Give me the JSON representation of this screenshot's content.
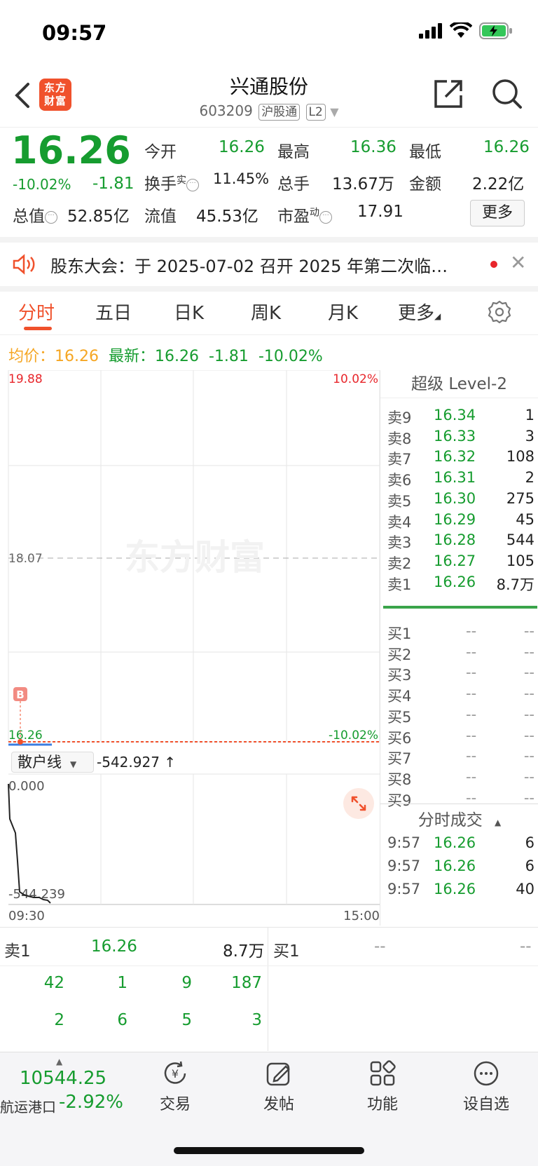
{
  "status": {
    "time": "09:57"
  },
  "nav": {
    "logo_line1": "东方",
    "logo_line2": "财富",
    "title": "兴通股份",
    "code": "603209",
    "tag1": "沪股通",
    "tag2": "L2"
  },
  "quote": {
    "price": "16.26",
    "pct": "-10.02%",
    "chg": "-1.81",
    "open_label": "今开",
    "open": "16.26",
    "high_label": "最高",
    "high": "16.36",
    "low_label": "最低",
    "low": "16.26",
    "turnover_label": "换手",
    "turnover_sup": "实",
    "turnover": "11.45%",
    "vol_label": "总手",
    "vol": "13.67万",
    "amount_label": "金额",
    "amount": "2.22亿",
    "mcap_label": "总值",
    "mcap": "52.85亿",
    "float_label": "流值",
    "float": "45.53亿",
    "pe_label": "市盈",
    "pe_sup": "动",
    "pe": "17.91",
    "more": "更多"
  },
  "notice": {
    "text": "股东大会：于 2025-07-02 召开 2025 年第二次临…"
  },
  "tabs": [
    "分时",
    "五日",
    "日K",
    "周K",
    "月K",
    "更多"
  ],
  "info": {
    "avg_label": "均价：",
    "avg": "16.26",
    "last_label": "最新：",
    "last": "16.26",
    "chg": "-1.81",
    "pct": "-10.02%"
  },
  "chart": {
    "y_top": "19.88",
    "y_top_pct": "10.02%",
    "y_mid": "18.07",
    "y_bottom": "16.26",
    "y_bottom_pct": "-10.02%",
    "marker": "B",
    "watermark": "东方财富",
    "sub_selector": "散户线",
    "sub_value": "-542.927 ↑",
    "sub_top": "0.000",
    "sub_bottom": "-544.239",
    "x_start": "09:30",
    "x_end": "15:00"
  },
  "book": {
    "title": "超级 Level-2",
    "asks": [
      {
        "label": "卖9",
        "price": "16.34",
        "vol": "1"
      },
      {
        "label": "卖8",
        "price": "16.33",
        "vol": "3"
      },
      {
        "label": "卖7",
        "price": "16.32",
        "vol": "108"
      },
      {
        "label": "卖6",
        "price": "16.31",
        "vol": "2"
      },
      {
        "label": "卖5",
        "price": "16.30",
        "vol": "275"
      },
      {
        "label": "卖4",
        "price": "16.29",
        "vol": "45"
      },
      {
        "label": "卖3",
        "price": "16.28",
        "vol": "544"
      },
      {
        "label": "卖2",
        "price": "16.27",
        "vol": "105"
      },
      {
        "label": "卖1",
        "price": "16.26",
        "vol": "8.7万"
      }
    ],
    "bids": [
      {
        "label": "买1",
        "price": "--",
        "vol": "--"
      },
      {
        "label": "买2",
        "price": "--",
        "vol": "--"
      },
      {
        "label": "买3",
        "price": "--",
        "vol": "--"
      },
      {
        "label": "买4",
        "price": "--",
        "vol": "--"
      },
      {
        "label": "买5",
        "price": "--",
        "vol": "--"
      },
      {
        "label": "买6",
        "price": "--",
        "vol": "--"
      },
      {
        "label": "买7",
        "price": "--",
        "vol": "--"
      },
      {
        "label": "买8",
        "price": "--",
        "vol": "--"
      },
      {
        "label": "买9",
        "price": "--",
        "vol": "--"
      }
    ],
    "trades_title": "分时成交",
    "trades": [
      {
        "time": "9:57",
        "price": "16.26",
        "vol": "6"
      },
      {
        "time": "9:57",
        "price": "16.26",
        "vol": "6"
      },
      {
        "time": "9:57",
        "price": "16.26",
        "vol": "40"
      }
    ]
  },
  "lower": {
    "ask_label": "卖1",
    "ask_price": "16.26",
    "ask_vol": "8.7万",
    "bid_label": "买1",
    "bid_price": "--",
    "bid_vol": "--",
    "row1": [
      "42",
      "1",
      "9",
      "187"
    ],
    "row2": [
      "2",
      "6",
      "5",
      "3"
    ]
  },
  "bottom": {
    "index_value": "10544.25",
    "index_name": "航运港口",
    "index_pct": "-2.92%",
    "buttons": [
      "交易",
      "发帖",
      "功能",
      "设自选"
    ]
  }
}
